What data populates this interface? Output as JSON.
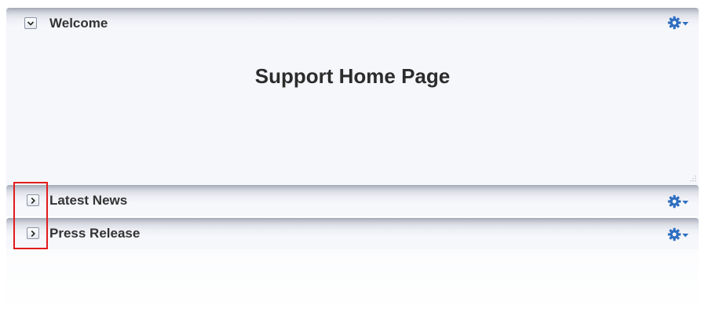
{
  "welcome_panel": {
    "title": "Welcome",
    "state": "expanded",
    "toggle_icon": "chevron-down-icon",
    "menu_icon": "gear-dropdown-icon",
    "body_heading": "Support Home Page"
  },
  "latest_news_panel": {
    "title": "Latest News",
    "state": "collapsed",
    "toggle_icon": "chevron-right-icon",
    "menu_icon": "gear-dropdown-icon"
  },
  "press_release_panel": {
    "title": "Press Release",
    "state": "collapsed",
    "toggle_icon": "chevron-right-icon",
    "menu_icon": "gear-dropdown-icon"
  },
  "colors": {
    "gear": "#2f6fc0",
    "highlight": "#e21b1b",
    "title_text": "#333333"
  }
}
